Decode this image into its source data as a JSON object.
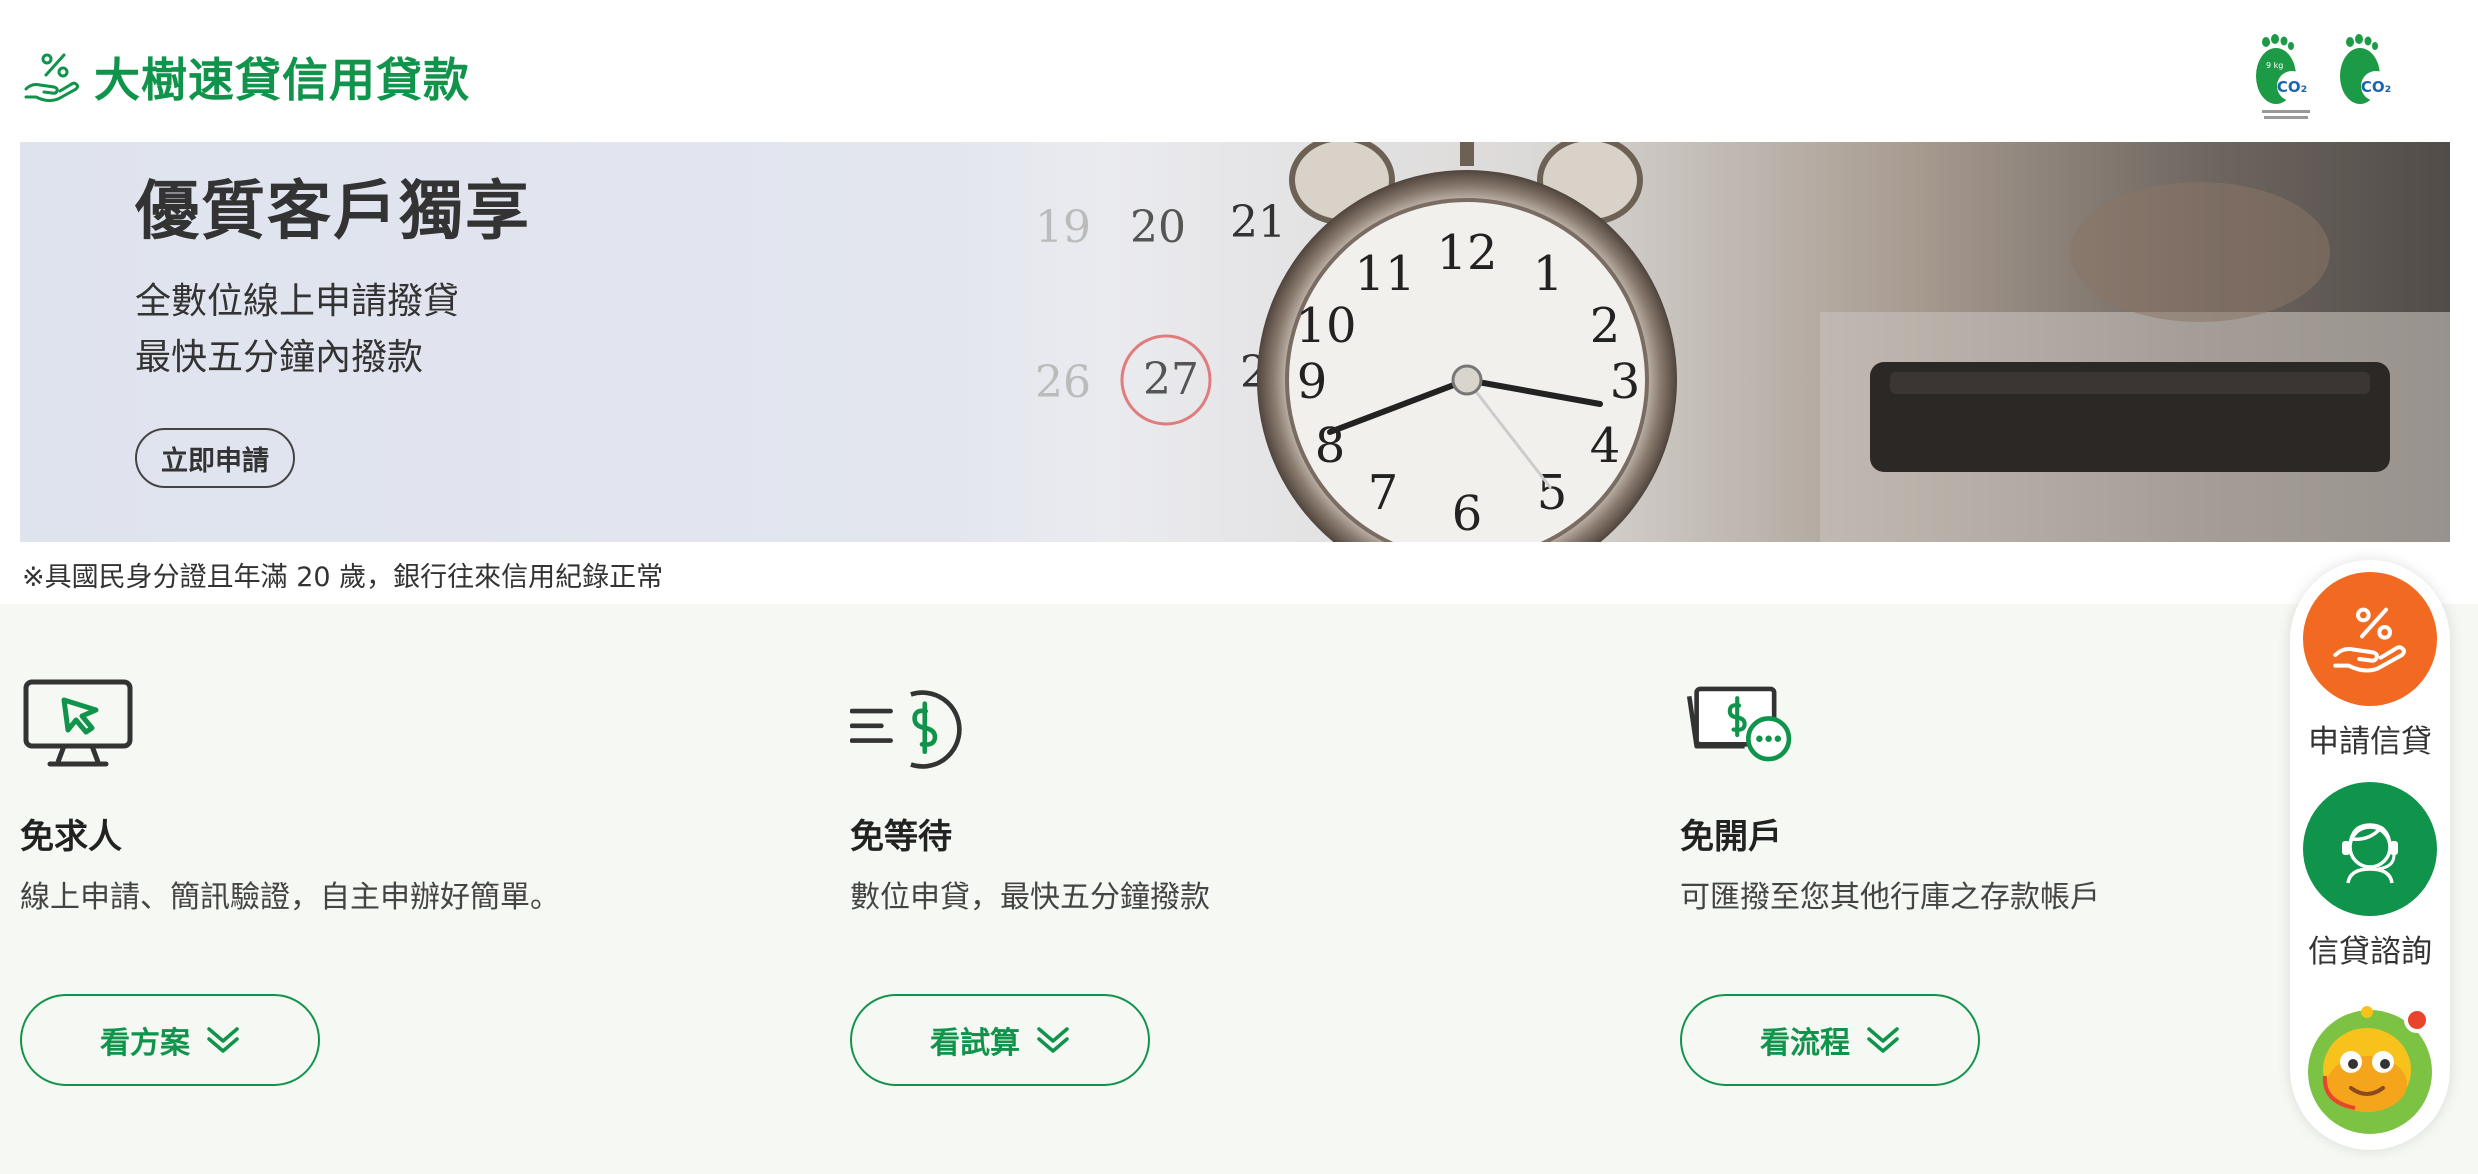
{
  "header": {
    "title": "大樹速貸信用貸款",
    "logo_icon": "hand-percent-icon",
    "badges": [
      {
        "icon": "carbon-footprint-label-icon",
        "text": "9 kg"
      },
      {
        "icon": "carbon-reduction-label-icon",
        "text": ""
      }
    ]
  },
  "hero": {
    "title": "優質客戶獨享",
    "subtitle_line1": "全數位線上申請撥貸",
    "subtitle_line2": "最快五分鐘內撥款",
    "cta_label": "立即申請",
    "calendar_numbers": [
      "19",
      "20",
      "21",
      "26",
      "27",
      "28"
    ]
  },
  "note": "※具國民身分證且年滿 20 歲，銀行往來信用紀錄正常",
  "features": [
    {
      "icon": "monitor-cursor-icon",
      "title": "免求人",
      "desc": "線上申請、簡訊驗證，自主申辦好簡單。",
      "button": "看方案"
    },
    {
      "icon": "fast-dollar-icon",
      "title": "免等待",
      "desc": "數位申貸，最快五分鐘撥款",
      "button": "看試算"
    },
    {
      "icon": "transfer-card-icon",
      "title": "免開戶",
      "desc": "可匯撥至您其他行庫之存款帳戶",
      "button": "看流程"
    }
  ],
  "side_panel": {
    "apply_label": "申請信貸",
    "consult_label": "信貸諮詢",
    "mascot": "chatbot-mascot-icon"
  },
  "colors": {
    "brand_green": "#10934a",
    "apply_orange": "#f26a21",
    "consult_green": "#10934a",
    "feature_bg": "#f6f8f3"
  }
}
